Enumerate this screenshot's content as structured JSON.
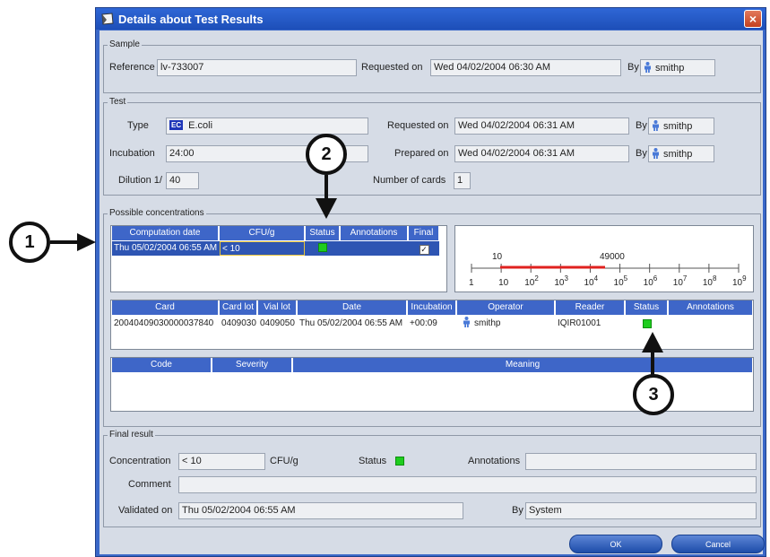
{
  "window": {
    "title": "Details about Test Results",
    "close_label": "×"
  },
  "sample": {
    "group_title": "Sample",
    "reference_label": "Reference",
    "reference_value": "lv-733007",
    "requested_on_label": "Requested on",
    "requested_on_value": "Wed 04/02/2004 06:30 AM",
    "by_label": "By",
    "by_value": "smithp"
  },
  "test": {
    "group_title": "Test",
    "type_label": "Type",
    "type_badge": "EC",
    "type_value": "E.coli",
    "requested_on_label": "Requested on",
    "requested_on_value": "Wed 04/02/2004 06:31 AM",
    "requested_by_label": "By",
    "requested_by_value": "smithp",
    "incubation_label": "Incubation",
    "incubation_value": "24:00",
    "prepared_on_label": "Prepared on",
    "prepared_on_value": "Wed 04/02/2004 06:31 AM",
    "prepared_by_label": "By",
    "prepared_by_value": "smithp",
    "dilution_label": "Dilution 1/",
    "dilution_value": "40",
    "cards_label": "Number of cards",
    "cards_value": "1"
  },
  "concentrations": {
    "group_title": "Possible concentrations",
    "headers": [
      "Computation date",
      "CFU/g",
      "Status",
      "Annotations",
      "Final"
    ],
    "rows": [
      {
        "date": "Thu 05/02/2004 06:55 AM",
        "cfu": "< 10",
        "status_color": "#1fcd1f",
        "annotations": "",
        "final_check": "✓"
      }
    ]
  },
  "range_scale": {
    "low_label": "10",
    "high_label": "49000",
    "ticks": [
      {
        "base": "1",
        "exp": ""
      },
      {
        "base": "10",
        "exp": ""
      },
      {
        "base": "10",
        "exp": "2"
      },
      {
        "base": "10",
        "exp": "3"
      },
      {
        "base": "10",
        "exp": "4"
      },
      {
        "base": "10",
        "exp": "5"
      },
      {
        "base": "10",
        "exp": "6"
      },
      {
        "base": "10",
        "exp": "7"
      },
      {
        "base": "10",
        "exp": "8"
      },
      {
        "base": "10",
        "exp": "9"
      }
    ],
    "range_color": "#e0211f"
  },
  "cards": {
    "headers": [
      "Card",
      "Card lot",
      "Vial lot",
      "Date",
      "Incubation",
      "Operator",
      "Reader",
      "Status",
      "Annotations"
    ],
    "rows": [
      {
        "card": "20040409030000037840",
        "card_lot": "0409030",
        "vial_lot": "0409050",
        "date": "Thu 05/02/2004 06:55 AM",
        "incubation": "+00:09",
        "operator": "smithp",
        "reader": "IQIR01001",
        "status_color": "#1fcd1f",
        "annotations": ""
      }
    ]
  },
  "codes": {
    "headers": [
      "Code",
      "Severity",
      "Meaning"
    ]
  },
  "final_result": {
    "group_title": "Final result",
    "concentration_label": "Concentration",
    "concentration_value": "< 10",
    "unit": "CFU/g",
    "status_label": "Status",
    "status_color": "#1fcd1f",
    "annotations_label": "Annotations",
    "annotations_value": "",
    "comment_label": "Comment",
    "comment_value": "",
    "validated_on_label": "Validated on",
    "validated_on_value": "Thu 05/02/2004 06:55 AM",
    "by_label": "By",
    "by_value": "System"
  },
  "buttons": {
    "ok": "OK",
    "cancel": "Cancel"
  },
  "callouts": [
    "1",
    "2",
    "3"
  ],
  "colors": {
    "title_bar": "#2f67d6",
    "header_blue": "#3e66c8",
    "status_green": "#1fcd1f",
    "close_red": "#c4401e"
  }
}
